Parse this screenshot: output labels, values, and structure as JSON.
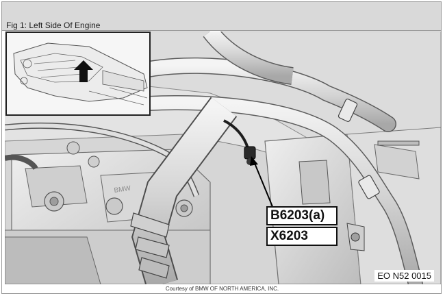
{
  "figure": {
    "title": "Fig 1: Left Side Of Engine",
    "callouts": {
      "sensor": "B6203(a)",
      "connector": "X6203"
    },
    "drawing_code": "EO N52 0015",
    "part_stamp": "BMW"
  },
  "footer": {
    "credit": "Courtesy of BMW OF NORTH AMERICA, INC."
  }
}
